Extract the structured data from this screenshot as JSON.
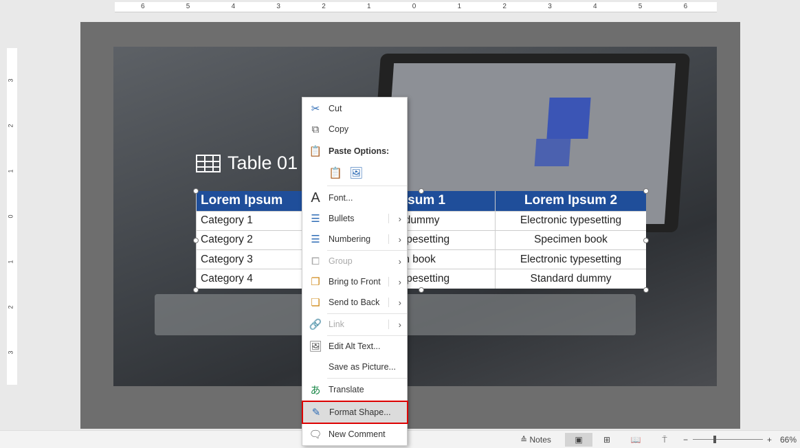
{
  "ruler": {
    "h": [
      "6",
      "5",
      "4",
      "3",
      "2",
      "1",
      "0",
      "1",
      "2",
      "3",
      "4",
      "5",
      "6"
    ],
    "v": [
      "3",
      "2",
      "1",
      "0",
      "1",
      "2",
      "3"
    ]
  },
  "slide": {
    "title": "Table 01",
    "table": {
      "headers": [
        "Lorem Ipsum",
        "Lorem Ipsum 1",
        "Lorem Ipsum 2"
      ],
      "rows": [
        [
          "Category 1",
          "Standard dummy",
          "Electronic typesetting"
        ],
        [
          "Category 2",
          "Electronic typesetting",
          "Specimen book"
        ],
        [
          "Category 3",
          "Specimen book",
          "Electronic typesetting"
        ],
        [
          "Category 4",
          "Electronic typesetting",
          "Standard dummy"
        ]
      ]
    }
  },
  "menu": {
    "cut": "Cut",
    "copy": "Copy",
    "paste_options": "Paste Options:",
    "font": "Font...",
    "bullets": "Bullets",
    "numbering": "Numbering",
    "group": "Group",
    "bring_front": "Bring to Front",
    "send_back": "Send to Back",
    "link": "Link",
    "alt_text": "Edit Alt Text...",
    "save_picture": "Save as Picture...",
    "translate": "Translate",
    "format_shape": "Format Shape...",
    "new_comment": "New Comment"
  },
  "status": {
    "notes": "Notes",
    "zoom": "66%",
    "zoom_fraction": 0.66
  },
  "colors": {
    "header": "#1f4e9a",
    "highlight": "#dd0000"
  }
}
